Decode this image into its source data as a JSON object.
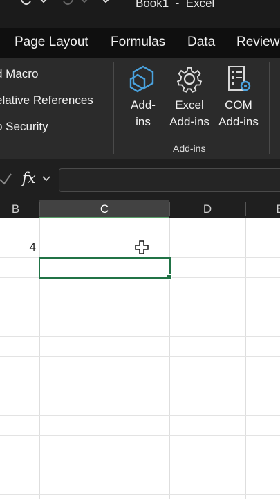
{
  "window": {
    "title": "Book1  -  Excel"
  },
  "tabs": [
    "Page Layout",
    "Formulas",
    "Data",
    "Review"
  ],
  "ribbon": {
    "code_group": {
      "items": [
        "d Macro",
        "elative References",
        "o Security"
      ]
    },
    "addins_group": {
      "label": "Add-ins",
      "buttons": [
        {
          "label_line1": "Add-",
          "label_line2": "ins",
          "icon": "add-ins-icon"
        },
        {
          "label_line1": "Excel",
          "label_line2": "Add-ins",
          "icon": "gear-icon"
        },
        {
          "label_line1": "COM",
          "label_line2": "Add-ins",
          "icon": "com-addins-icon"
        }
      ]
    }
  },
  "formula_bar": {
    "fx": "fx",
    "value": ""
  },
  "columns": [
    "B",
    "C",
    "D",
    "E"
  ],
  "selected_column": "C",
  "cells": [
    {
      "col": "B",
      "row": 2,
      "value": "4"
    }
  ],
  "colors": {
    "excel_green": "#217346",
    "ribbon_bg": "#2b2b2b",
    "addin_blue": "#4aa3df"
  }
}
